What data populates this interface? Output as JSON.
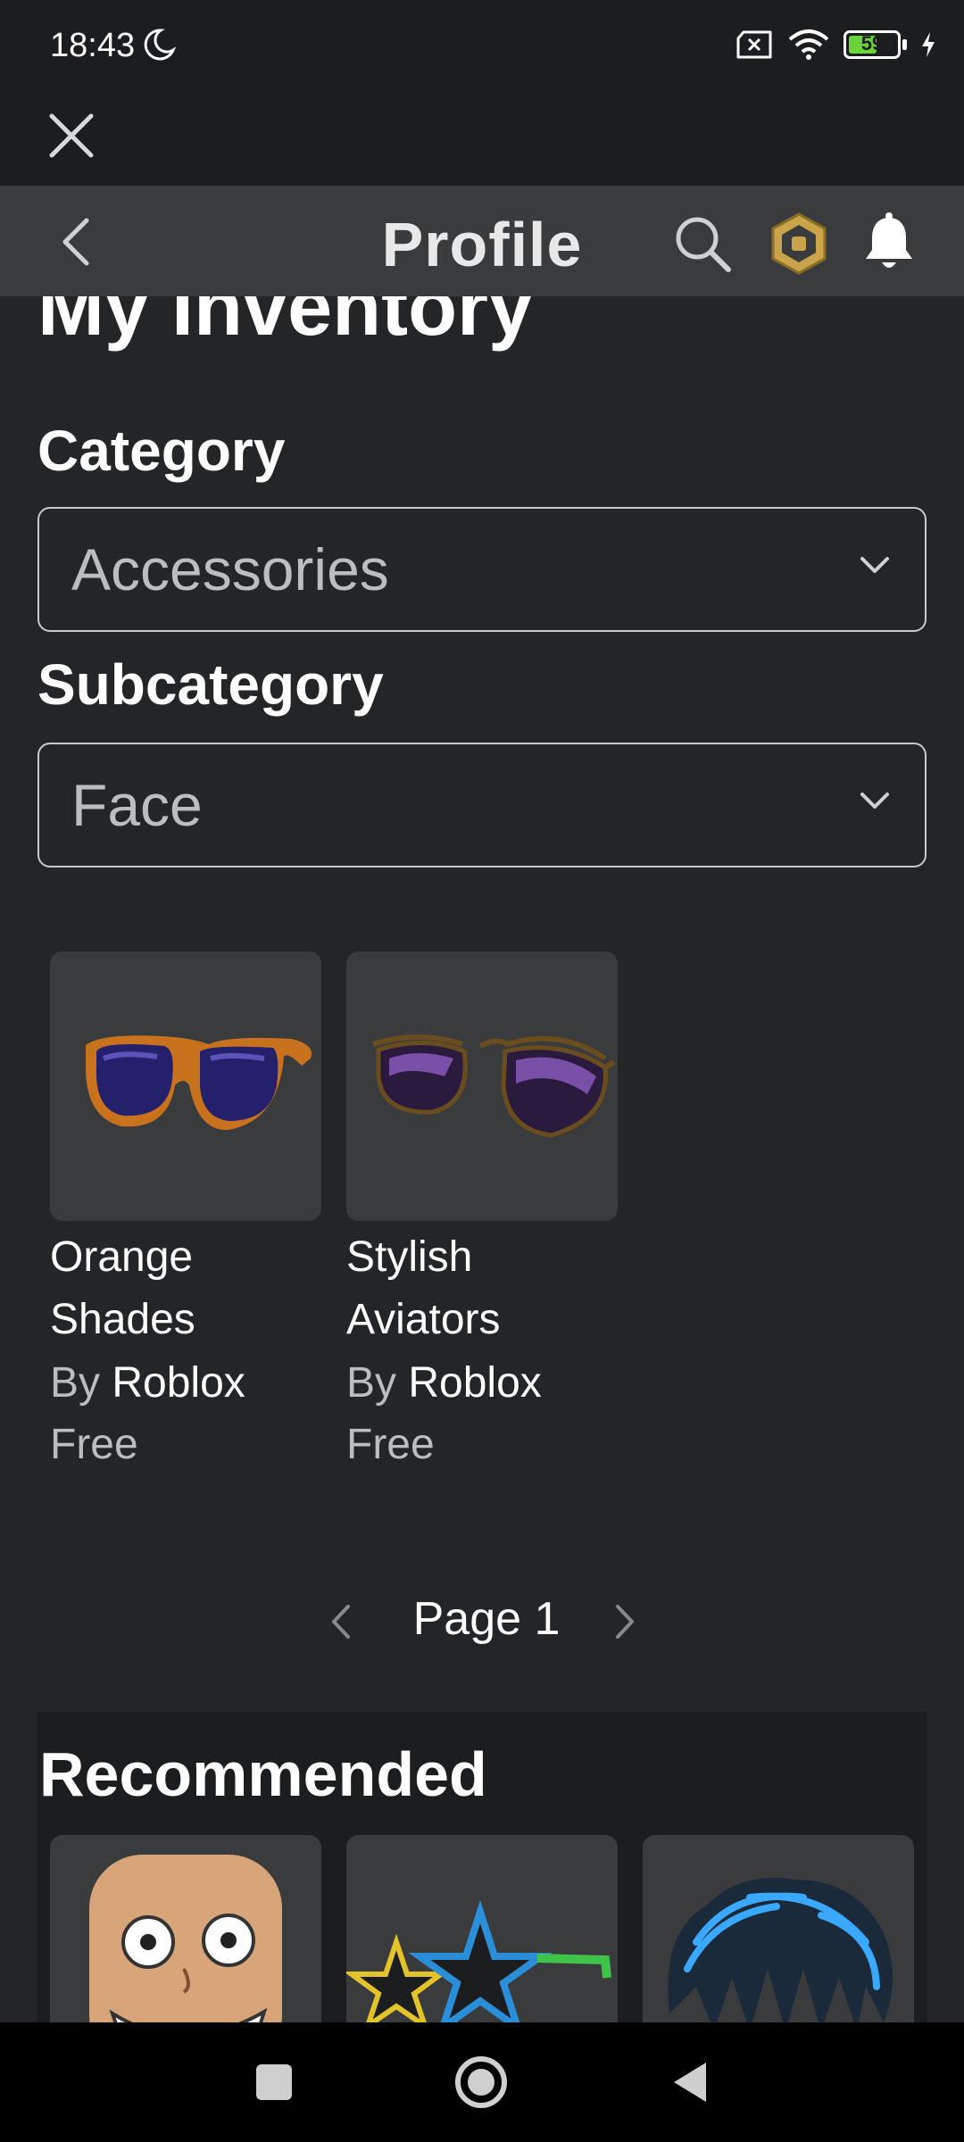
{
  "status_bar": {
    "time": "18:43",
    "battery_level": "59",
    "battery_fraction": 0.59
  },
  "nav": {
    "title": "Profile"
  },
  "page": {
    "heading": "My Inventory"
  },
  "filters": {
    "category_label": "Category",
    "category_value": "Accessories",
    "subcategory_label": "Subcategory",
    "subcategory_value": "Face"
  },
  "items": [
    {
      "name_line1": "Orange",
      "name_line2": "Shades",
      "by": "By",
      "creator": "Roblox",
      "price": "Free",
      "icon": "orange-shades-icon"
    },
    {
      "name_line1": "Stylish",
      "name_line2": "Aviators",
      "by": "By",
      "creator": "Roblox",
      "price": "Free",
      "icon": "stylish-aviators-icon"
    }
  ],
  "pagination": {
    "label": "Page 1"
  },
  "recommended": {
    "title": "Recommended"
  },
  "colors": {
    "background": "#232527",
    "navbar": "#393b3d",
    "card": "#393b3d",
    "robux_gold": "#c9a44a"
  }
}
